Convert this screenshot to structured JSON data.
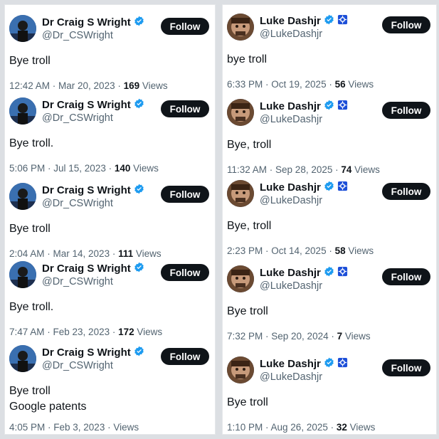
{
  "left": {
    "tweets": [
      {
        "name": "Dr Craig S Wright",
        "handle": "@Dr_CSWright",
        "follow": "Follow",
        "text": "Bye troll",
        "time": "12:42 AM · Mar 20, 2023 · ",
        "views": "169",
        "views_label": " Views"
      },
      {
        "name": "Dr Craig S Wright",
        "handle": "@Dr_CSWright",
        "follow": "Follow",
        "text": "Bye troll.",
        "time": "5:06 PM · Jul 15, 2023 · ",
        "views": "140",
        "views_label": " Views"
      },
      {
        "name": "Dr Craig S Wright",
        "handle": "@Dr_CSWright",
        "follow": "Follow",
        "text": "Bye troll",
        "time": "2:04 AM · Mar 14, 2023 · ",
        "views": "111",
        "views_label": " Views"
      },
      {
        "name": "Dr Craig S Wright",
        "handle": "@Dr_CSWright",
        "follow": "Follow",
        "text": "Bye troll.",
        "time": "7:47 AM · Feb 23, 2023 · ",
        "views": "172",
        "views_label": " Views"
      },
      {
        "name": "Dr Craig S Wright",
        "handle": "@Dr_CSWright",
        "follow": "Follow",
        "text": "Bye troll",
        "text2": "Google patents",
        "time": "4:05 PM · Feb 3, 2023 · ",
        "views": "",
        "views_label": " Views"
      }
    ]
  },
  "right": {
    "tweets": [
      {
        "name": "Luke Dashjr",
        "handle": "@LukeDashjr",
        "follow": "Follow",
        "text": "bye troll",
        "time": "6:33 PM · Oct 19, 2025 · ",
        "views": "56",
        "views_label": " Views"
      },
      {
        "name": "Luke Dashjr",
        "handle": "@LukeDashjr",
        "follow": "Follow",
        "text": "Bye, troll",
        "time": "11:32 AM · Sep 28, 2025 · ",
        "views": "74",
        "views_label": " Views"
      },
      {
        "name": "Luke Dashjr",
        "handle": "@LukeDashjr",
        "follow": "Follow",
        "text": "Bye, troll",
        "time": "2:23 PM · Oct 14, 2025 · ",
        "views": "58",
        "views_label": " Views"
      },
      {
        "name": "Luke Dashjr",
        "handle": "@LukeDashjr",
        "follow": "Follow",
        "text": "Bye troll",
        "time": "7:32 PM · Sep 20, 2024 · ",
        "views": "7",
        "views_label": " Views"
      },
      {
        "name": "Luke Dashjr",
        "handle": "@LukeDashjr",
        "follow": "Follow",
        "text": "Bye troll",
        "time": "1:10 PM · Aug 26, 2025 · ",
        "views": "32",
        "views_label": " Views"
      }
    ]
  },
  "colors": {
    "verified": "#1d9bf0",
    "follow_bg": "#0f1419",
    "secondary_text": "#536471"
  }
}
